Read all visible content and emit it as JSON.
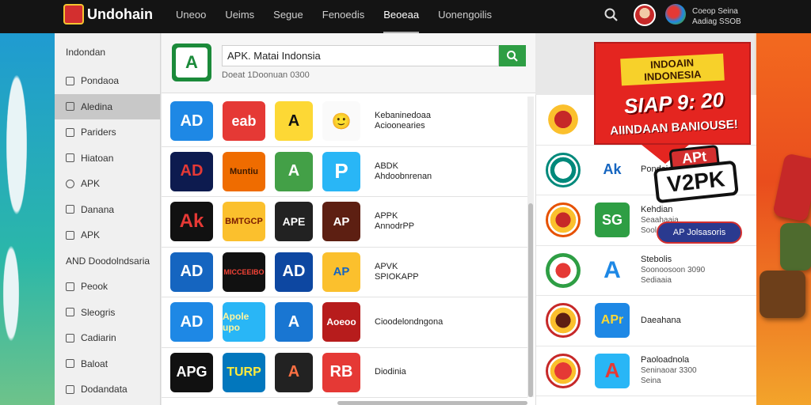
{
  "app": {
    "name": "Undohain"
  },
  "nav": [
    "Uneoo",
    "Ueims",
    "Segue",
    "Fenoedis",
    "Beoeaa",
    "Uonengoilis"
  ],
  "account": {
    "line1": "Coeop Seina",
    "line2": "Aadiag SSOB"
  },
  "sidebar": {
    "header": "Indondan",
    "items": [
      {
        "label": "Pondaoa"
      },
      {
        "label": "Aledina"
      },
      {
        "label": "Pariders"
      },
      {
        "label": "Hiatoan"
      },
      {
        "label": "APK"
      },
      {
        "label": "Danana"
      },
      {
        "label": "APK"
      },
      {
        "label": "AND Doodolndsaria"
      },
      {
        "label": "Peook"
      },
      {
        "label": "Sleogris"
      },
      {
        "label": "Cadiarin"
      },
      {
        "label": "Baloat"
      },
      {
        "label": "Dodandata"
      }
    ]
  },
  "search": {
    "value": "APK. Matai Indonsia",
    "result_count": "Doeat 1Doonuan 0300",
    "logo": "A"
  },
  "grid": {
    "rows": [
      {
        "icons": [
          "AD",
          "eab",
          "A",
          "🙂"
        ],
        "text1": "Kebaninedoaa",
        "text2": "Acioonearies"
      },
      {
        "icons": [
          "AD",
          "Muntiu",
          "A",
          "P"
        ],
        "text1": "ABDK",
        "text2": "Ahdoobnrenan"
      },
      {
        "icons": [
          "Ak",
          "BMTGCP",
          "APE",
          "AP"
        ],
        "text1": "APPK",
        "text2": "AnnodrPP"
      },
      {
        "icons": [
          "AD",
          "MICCEEIBO",
          "AD",
          "AP"
        ],
        "text1": "APVK",
        "text2": "SPIOKAPP"
      },
      {
        "icons": [
          "AD",
          "Apole upo",
          "A",
          "Aoeoo"
        ],
        "text1": "Cioodelondngona",
        "text2": ""
      },
      {
        "icons": [
          "APG",
          "TURP",
          "A",
          "RB"
        ],
        "text1": "Diodinia",
        "text2": ""
      }
    ]
  },
  "right": {
    "rows": [
      {
        "square": "",
        "title": "",
        "sub1": "",
        "sub2": ""
      },
      {
        "square": "Ak",
        "title": "Pondaiae",
        "sub1": "",
        "sub2": ""
      },
      {
        "square": "SG",
        "title": "Kehdian",
        "sub1": "Seaahaaia",
        "sub2": "Soolaan"
      },
      {
        "square": "A",
        "title": "Stebolis",
        "sub1": "Soonoosoon 3090",
        "sub2": "Sediaaia"
      },
      {
        "square": "APr",
        "title": "Daeahana",
        "sub1": "",
        "sub2": ""
      },
      {
        "square": "A",
        "title": "Paoloadnola",
        "sub1": "Seninaoar 3300",
        "sub2": "Seina"
      }
    ]
  },
  "promo": {
    "title": "INDOAIN INDONESIA",
    "big": "SIAP 9: 20",
    "sub": "AIINDAAN BANIOUSE!",
    "badge_top": "APt",
    "badge_main": "V2PK",
    "button": "AP Jolsasoris"
  },
  "colors": {
    "accent_green": "#2e9e44",
    "promo_red": "#e42520",
    "topbar": "#141414"
  }
}
